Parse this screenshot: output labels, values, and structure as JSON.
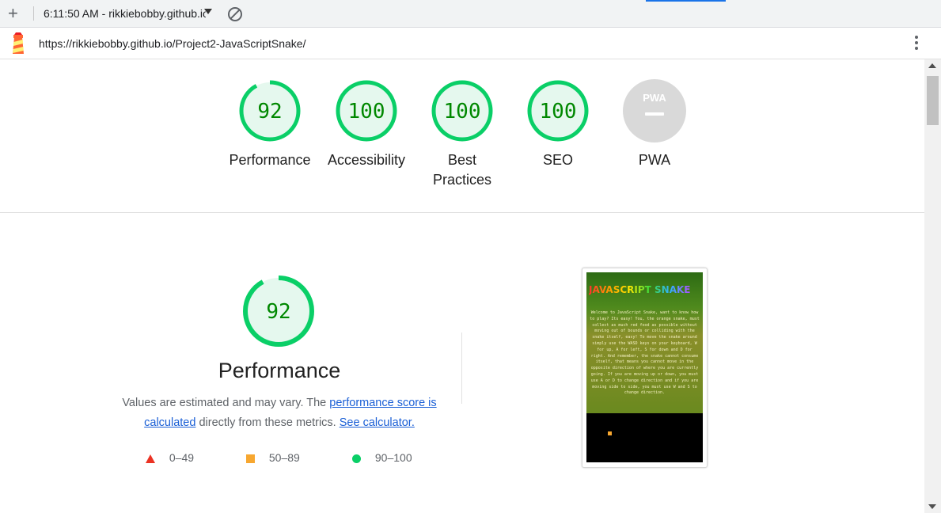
{
  "toolbar": {
    "report_select": "6:11:50 AM - rikkiebobby.github.io",
    "url": "https://rikkiebobby.github.io/Project2-JavaScriptSnake/"
  },
  "scores": [
    {
      "label": "Performance",
      "value": "92",
      "score": 92
    },
    {
      "label": "Accessibility",
      "value": "100",
      "score": 100
    },
    {
      "label": "Best Practices",
      "value": "100",
      "score": 100
    },
    {
      "label": "SEO",
      "value": "100",
      "score": 100
    },
    {
      "label": "PWA",
      "value": "PWA",
      "score": null
    }
  ],
  "performance": {
    "score": "92",
    "score_value": 92,
    "title": "Performance",
    "desc_prefix": "Values are estimated and may vary. The ",
    "desc_link": "performance score is calculated",
    "desc_middle": " directly from these metrics. ",
    "desc_calc": "See calculator."
  },
  "legend": [
    {
      "range": "0–49",
      "color": "#eb3223"
    },
    {
      "range": "50–89",
      "color": "#f7a730"
    },
    {
      "range": "90–100",
      "color": "#0acf67"
    }
  ],
  "page_screenshot": {
    "title": "JAVASCRIPT SNAKE",
    "body": "Welcome to JavaScript Snake, want to know how to play? Its easy! You, the orange snake, must collect as much red food as possible without moving out of bounds or colliding with the snake itself, easy! To move the snake around simply use the WASD keys on your keyboard, W for up, A for left, S for down and D for right. And remember, the snake cannot consume itself, that means you cannot move in the opposite direction of where you are currently going. If you are moving up or down, you must use A or D to change direction and if you are moving side to side, you must use W and S to change direction."
  },
  "colors": {
    "pass": "#0acf67",
    "pass_fill": "#e5f8ee",
    "pass_text": "#008800",
    "pwa_gray": "#d9d9d9"
  }
}
